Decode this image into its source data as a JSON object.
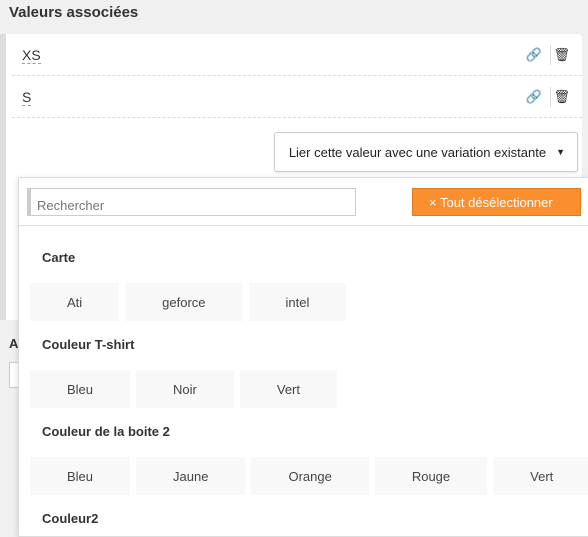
{
  "title": "Valeurs associées",
  "values": [
    {
      "label": "XS",
      "link_icon": "link-icon",
      "delete_icon": "trash-icon"
    },
    {
      "label": "S",
      "link_icon": "link-icon",
      "delete_icon": "trash-icon"
    }
  ],
  "link_button": {
    "label": "Lier cette valeur avec une variation existante"
  },
  "bottom_label": "A",
  "dropdown": {
    "search_placeholder": "Rechercher",
    "deselect_label": "× Tout désélectionner",
    "accent": "#fb8f2e",
    "groups": [
      {
        "title": "Carte",
        "options": [
          "Ati",
          "geforce",
          "intel"
        ]
      },
      {
        "title": "Couleur T-shirt",
        "options": [
          "Bleu",
          "Noir",
          "Vert"
        ]
      },
      {
        "title": "Couleur de la boite 2",
        "options": [
          "Bleu",
          "Jaune",
          "Orange",
          "Rouge",
          "Vert"
        ]
      },
      {
        "title": "Couleur2",
        "options": []
      }
    ]
  }
}
